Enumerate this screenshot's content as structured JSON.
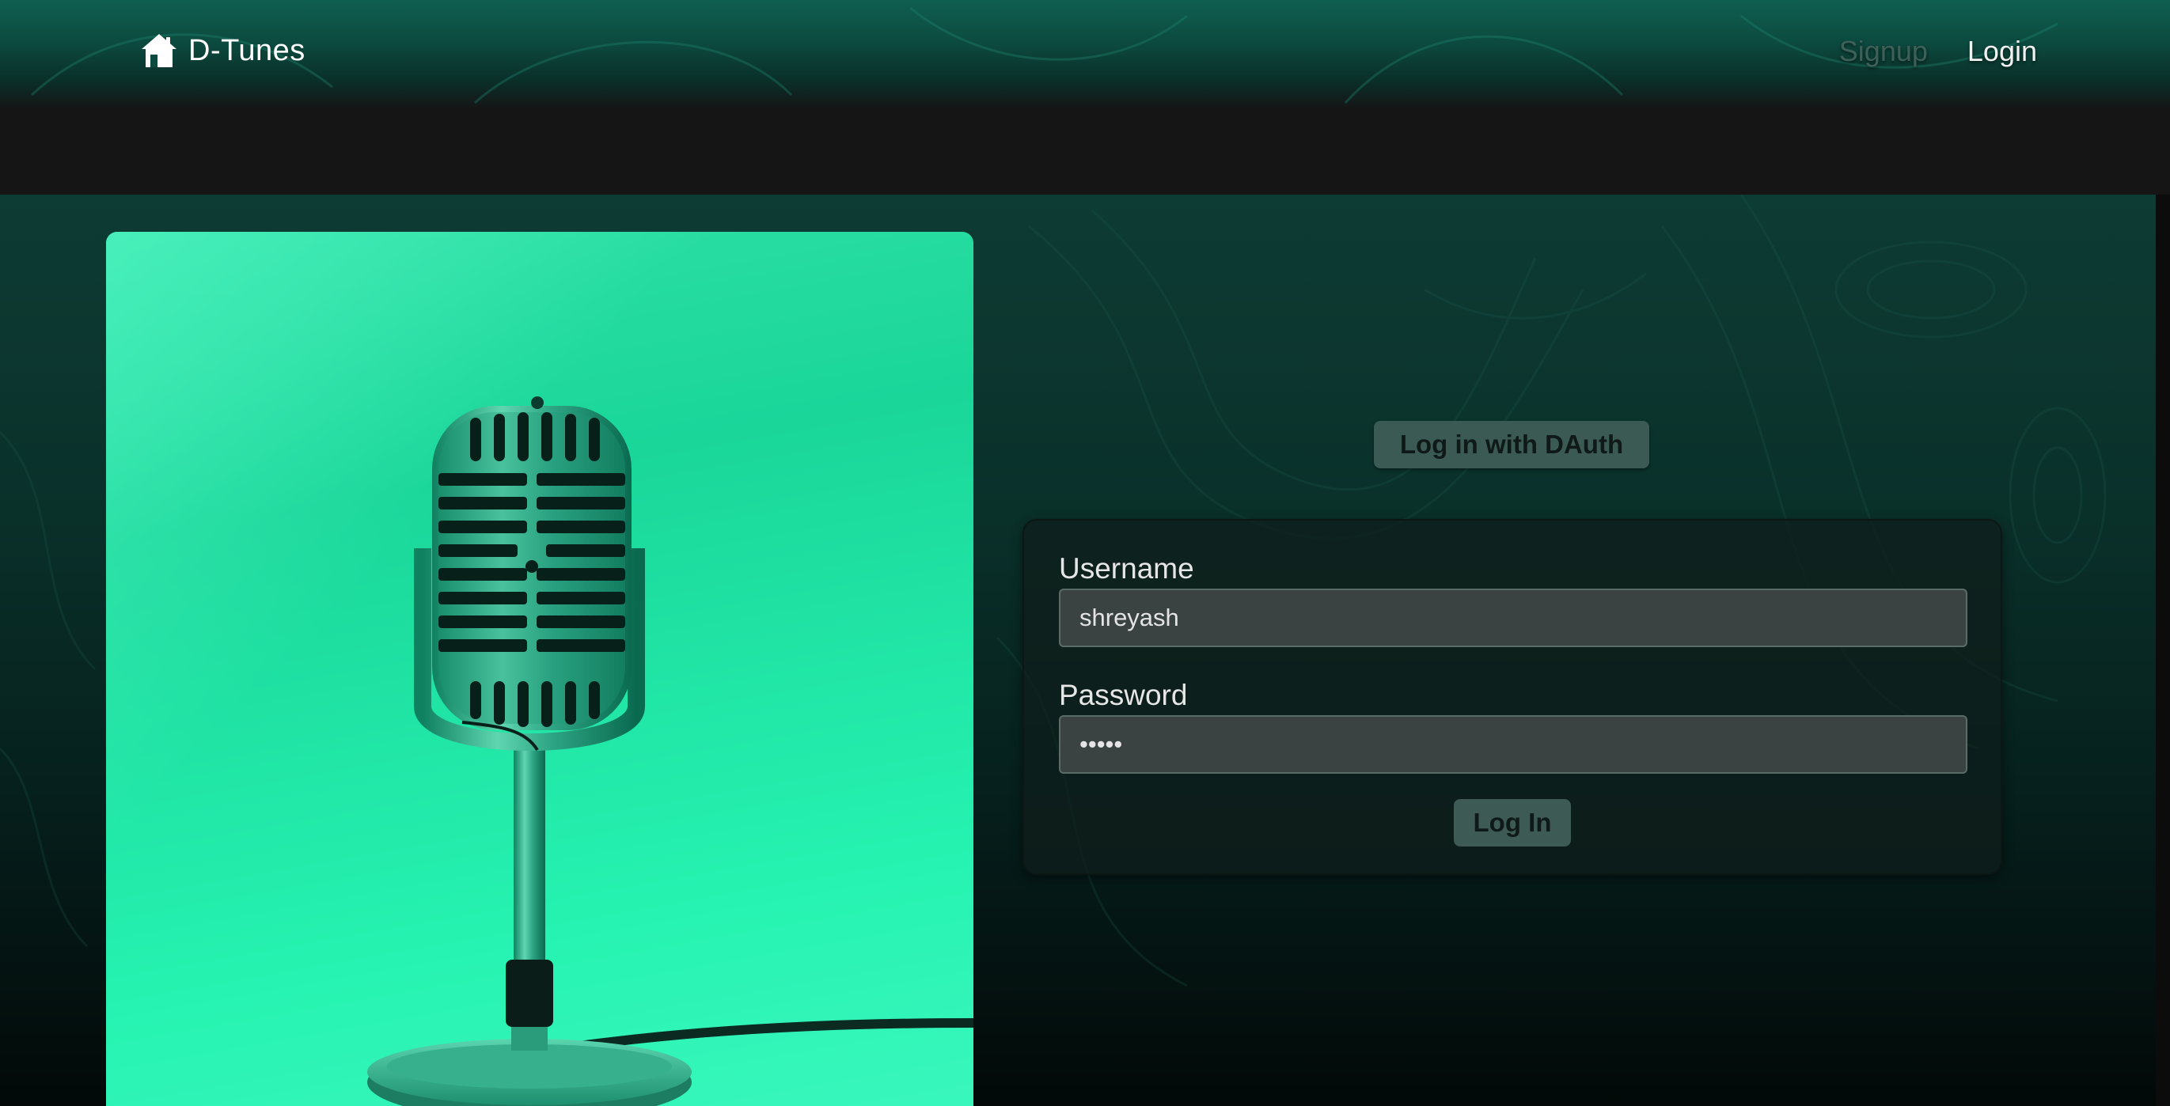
{
  "navbar": {
    "brand": "D-Tunes",
    "links": [
      {
        "label": "Signup",
        "active": false
      },
      {
        "label": "Login",
        "active": true
      }
    ]
  },
  "auth": {
    "dauth_button": "Log in with DAuth"
  },
  "login_form": {
    "username_label": "Username",
    "username_value": "shreyash",
    "password_label": "Password",
    "password_value": "•••••",
    "submit_label": "Log In"
  },
  "colors": {
    "accent": "#26f3b1",
    "navbar": "#0f5f50",
    "background": "#151515"
  },
  "icons": {
    "brand": "home-icon"
  }
}
